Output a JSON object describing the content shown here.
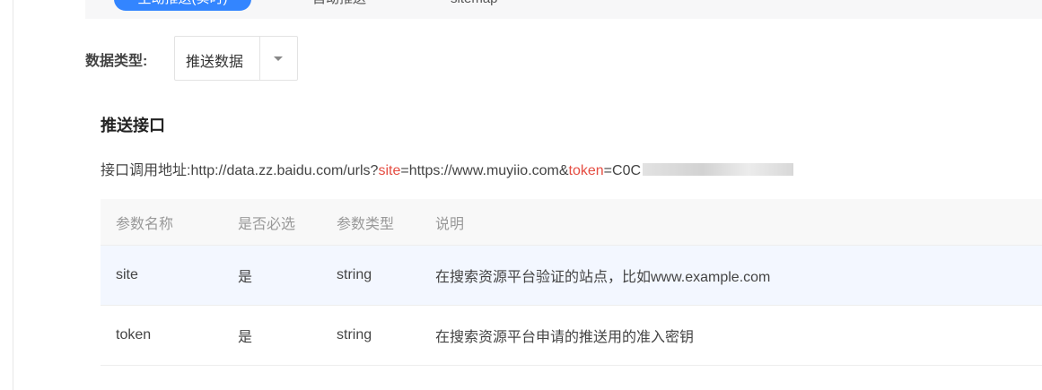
{
  "tabs": [
    {
      "label": "主动推送(实时)",
      "active": true
    },
    {
      "label": "自动推送",
      "active": false
    },
    {
      "label": "sitemap",
      "active": false
    }
  ],
  "data_type": {
    "label": "数据类型:",
    "selected": "推送数据"
  },
  "section": {
    "title": "推送接口",
    "api_prefix": "接口调用地址:",
    "url_base": "http://data.zz.baidu.com/urls?",
    "param_site": "site",
    "site_value": "=https://www.muyiio.com&",
    "param_token": "token",
    "token_value": "=C0C"
  },
  "table": {
    "headers": [
      "参数名称",
      "是否必选",
      "参数类型",
      "说明"
    ],
    "rows": [
      [
        "site",
        "是",
        "string",
        "在搜索资源平台验证的站点，比如www.example.com"
      ],
      [
        "token",
        "是",
        "string",
        "在搜索资源平台申请的推送用的准入密钥"
      ]
    ]
  },
  "colors": {
    "accent": "#3385ff",
    "highlight": "#e54d42",
    "row_highlight": "#f3f7ff"
  }
}
